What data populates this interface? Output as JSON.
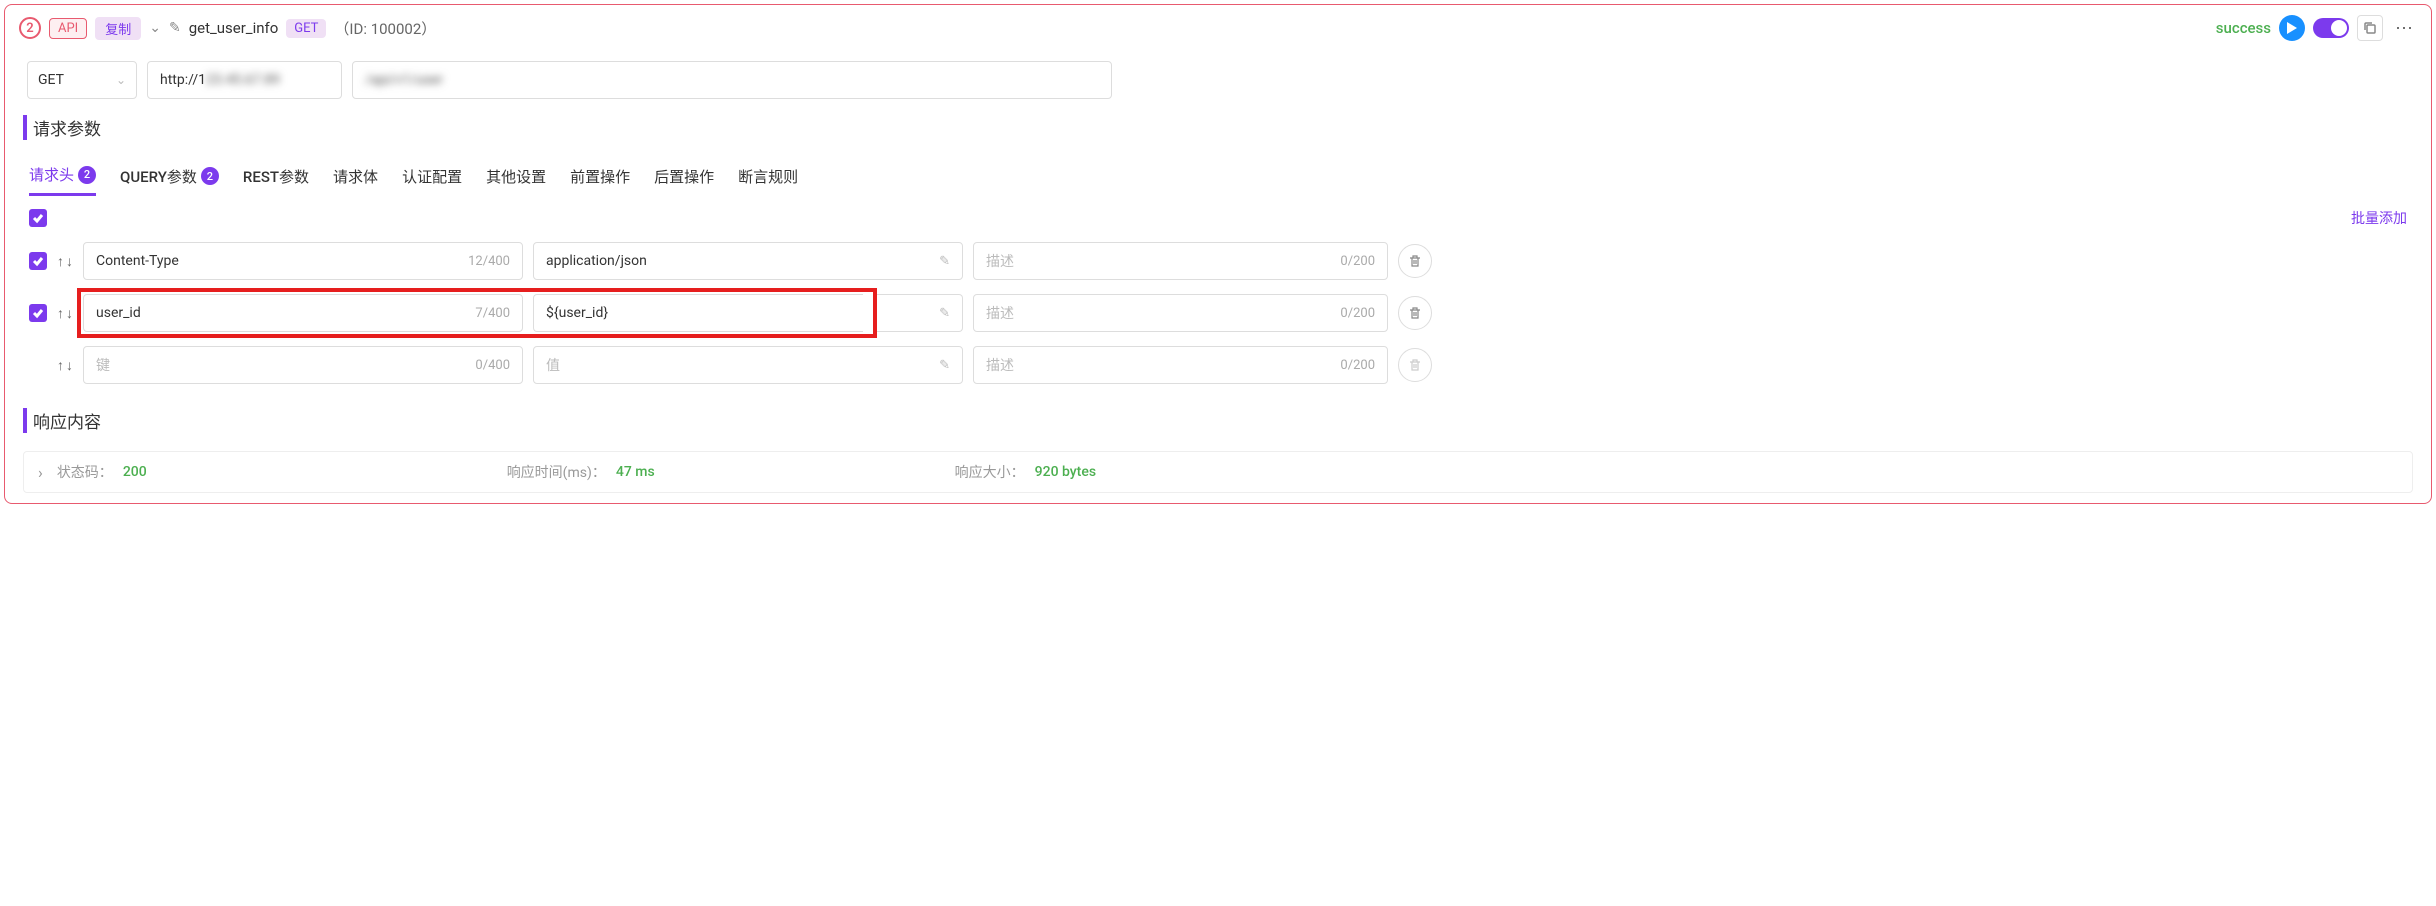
{
  "header": {
    "step_number": "2",
    "api_tag": "API",
    "copy_label": "复制",
    "title": "get_user_info",
    "method_tag": "GET",
    "id_text": "（ID: 100002）",
    "status": "success"
  },
  "url": {
    "method": "GET",
    "host_prefix": "http://1",
    "host_blur": "23.45.67.89",
    "path_blur": "/api/v1/user"
  },
  "sections": {
    "request_params": "请求参数",
    "response_content": "响应内容"
  },
  "tabs": [
    {
      "label": "请求头",
      "badge": "2",
      "active": true
    },
    {
      "label": "QUERY参数",
      "badge": "2",
      "active": false
    },
    {
      "label": "REST参数",
      "badge": null,
      "active": false
    },
    {
      "label": "请求体",
      "badge": null,
      "active": false
    },
    {
      "label": "认证配置",
      "badge": null,
      "active": false
    },
    {
      "label": "其他设置",
      "badge": null,
      "active": false
    },
    {
      "label": "前置操作",
      "badge": null,
      "active": false
    },
    {
      "label": "后置操作",
      "badge": null,
      "active": false
    },
    {
      "label": "断言规则",
      "badge": null,
      "active": false
    }
  ],
  "batch_add": "批量添加",
  "placeholders": {
    "key": "键",
    "value": "值",
    "desc": "描述"
  },
  "rows": [
    {
      "checked": true,
      "key": "Content-Type",
      "key_count": "12/400",
      "value": "application/json",
      "desc": "",
      "desc_count": "0/200",
      "highlight": false
    },
    {
      "checked": true,
      "key": "user_id",
      "key_count": "7/400",
      "value": "${user_id}",
      "desc": "",
      "desc_count": "0/200",
      "highlight": true
    },
    {
      "checked": false,
      "key": "",
      "key_count": "0/400",
      "value": "",
      "desc": "",
      "desc_count": "0/200",
      "highlight": false,
      "empty": true
    }
  ],
  "response": {
    "status_label": "状态码：",
    "status_value": "200",
    "time_label": "响应时间(ms)：",
    "time_value": "47 ms",
    "size_label": "响应大小：",
    "size_value": "920 bytes"
  }
}
